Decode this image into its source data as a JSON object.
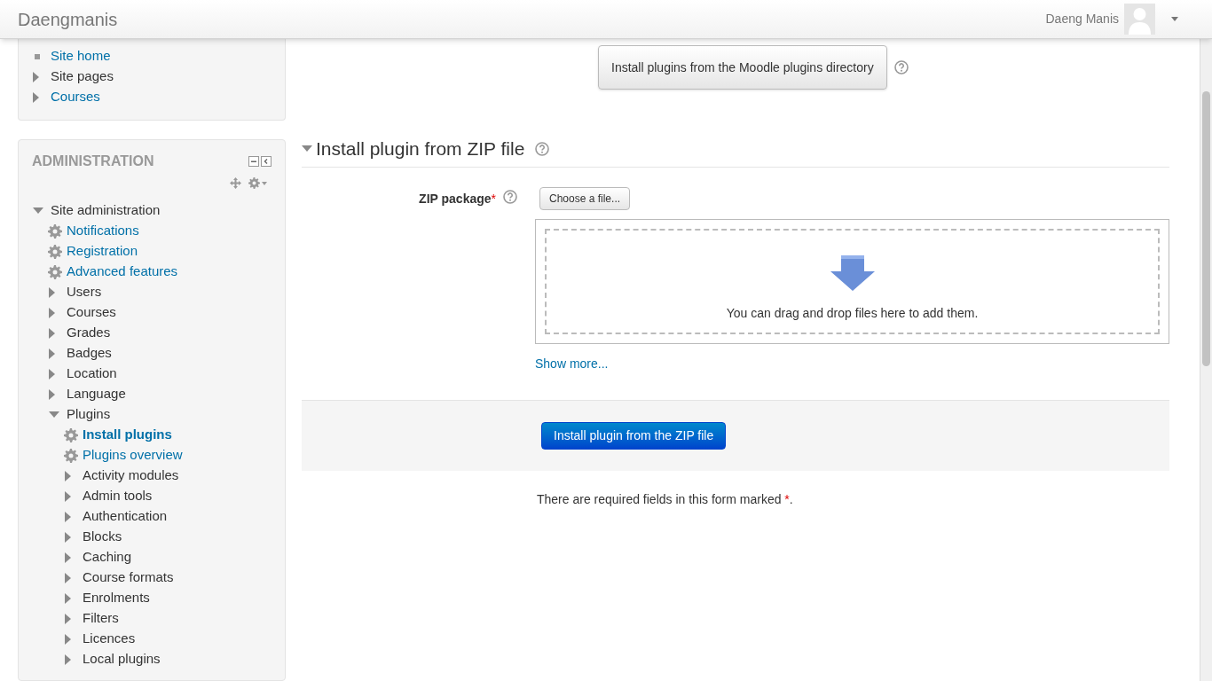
{
  "header": {
    "site_name": "Daengmanis",
    "user_name": "Daeng Manis"
  },
  "navigation": {
    "items": [
      {
        "label": "Site home",
        "kind": "leaf",
        "link": true
      },
      {
        "label": "Site pages",
        "kind": "category",
        "link": false,
        "expanded": false
      },
      {
        "label": "Courses",
        "kind": "category",
        "link": true,
        "expanded": false
      }
    ]
  },
  "administration": {
    "title": "ADMINISTRATION",
    "tree": [
      {
        "label": "Site administration",
        "kind": "category",
        "expanded": true,
        "children": [
          {
            "label": "Notifications",
            "kind": "page",
            "selected": false
          },
          {
            "label": "Registration",
            "kind": "page",
            "selected": false
          },
          {
            "label": "Advanced features",
            "kind": "page",
            "selected": false
          },
          {
            "label": "Users",
            "kind": "category",
            "expanded": false
          },
          {
            "label": "Courses",
            "kind": "category",
            "expanded": false
          },
          {
            "label": "Grades",
            "kind": "category",
            "expanded": false
          },
          {
            "label": "Badges",
            "kind": "category",
            "expanded": false
          },
          {
            "label": "Location",
            "kind": "category",
            "expanded": false
          },
          {
            "label": "Language",
            "kind": "category",
            "expanded": false
          },
          {
            "label": "Plugins",
            "kind": "category",
            "expanded": true,
            "children": [
              {
                "label": "Install plugins",
                "kind": "page",
                "selected": true
              },
              {
                "label": "Plugins overview",
                "kind": "page",
                "selected": false
              },
              {
                "label": "Activity modules",
                "kind": "category",
                "expanded": false
              },
              {
                "label": "Admin tools",
                "kind": "category",
                "expanded": false
              },
              {
                "label": "Authentication",
                "kind": "category",
                "expanded": false
              },
              {
                "label": "Blocks",
                "kind": "category",
                "expanded": false
              },
              {
                "label": "Caching",
                "kind": "category",
                "expanded": false
              },
              {
                "label": "Course formats",
                "kind": "category",
                "expanded": false
              },
              {
                "label": "Enrolments",
                "kind": "category",
                "expanded": false
              },
              {
                "label": "Filters",
                "kind": "category",
                "expanded": false
              },
              {
                "label": "Licences",
                "kind": "category",
                "expanded": false
              },
              {
                "label": "Local plugins",
                "kind": "category",
                "expanded": false
              }
            ]
          }
        ]
      }
    ]
  },
  "main": {
    "directory_button": "Install plugins from the Moodle plugins directory",
    "section": {
      "title": "Install plugin from ZIP file",
      "expanded": true
    },
    "zip_field": {
      "label": "ZIP package",
      "required_mark": "*",
      "choose_button": "Choose a file...",
      "drop_hint": "You can drag and drop files here to add them.",
      "show_more": "Show more..."
    },
    "submit_button": "Install plugin from the ZIP file",
    "required_note": "There are required fields in this form marked ",
    "required_note_mark": "*",
    "required_note_end": "."
  }
}
